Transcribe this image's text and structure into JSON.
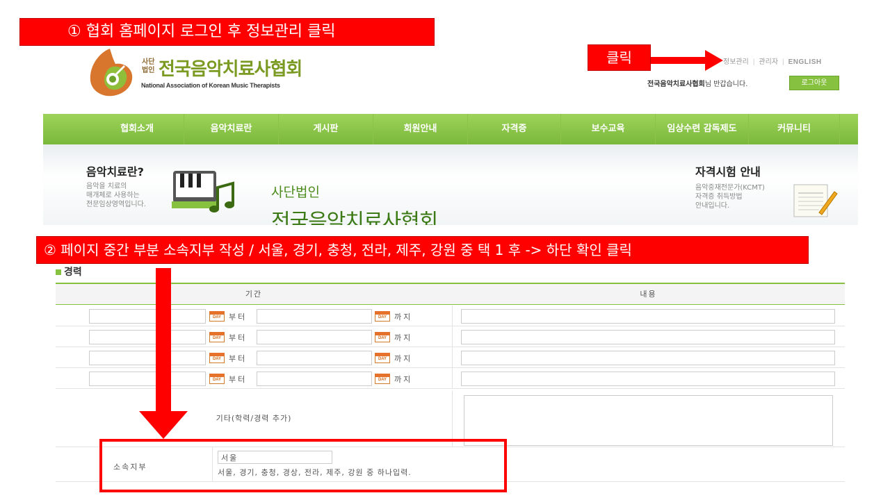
{
  "annotations": {
    "step1": "① 협회 홈페이지 로그인 후 정보관리 클릭",
    "step2": "② 페이지 중간 부분 소속지부 작성 / 서울, 경기, 충청, 전라, 제주, 강원 중 택 1 후 -> 하단 확인 클릭",
    "click": "클릭",
    "color": "#ff0000"
  },
  "header": {
    "logo": {
      "small_top": "사단",
      "small_bottom": "법인",
      "name_ko": "전국음악치료사협회",
      "name_en": "National Association of Korean Music Therapists"
    },
    "util_links": [
      "정보관리",
      "관리자",
      "ENGLISH"
    ],
    "welcome_name": "전국음악치료사협회",
    "welcome_suffix": "님 반갑습니다.",
    "logout": "로그아웃"
  },
  "nav": {
    "color": "#86c13f",
    "items": [
      "협회소개",
      "음악치료란",
      "게시판",
      "회원안내",
      "자격증",
      "보수교육",
      "임상수련 감독제도",
      "커뮤니티"
    ]
  },
  "banner": {
    "left_title": "음악치료란?",
    "left_desc": [
      "음악을 치료의",
      "매개체로 사용하는",
      "전문임상영역입니다."
    ],
    "center_sub": "사단법인",
    "center_main": "전국음악치료사협회",
    "right_title": "자격시험 안내",
    "right_desc": [
      "음악중재전문가(KCMT)",
      "자격증 취득방법",
      "안내입니다."
    ]
  },
  "career": {
    "title": "경력",
    "col_period": "기간",
    "col_content": "내용",
    "from_label": "부터",
    "to_label": "까지",
    "calendar_icon_text": "DAY",
    "rows": 4,
    "etc_label": "기타(학력/경력 추가)",
    "branch_label": "소속지부",
    "branch_value": "서울",
    "branch_hint": "서울, 경기, 충청, 경상, 전라, 제주, 강원 중 하나입력."
  }
}
